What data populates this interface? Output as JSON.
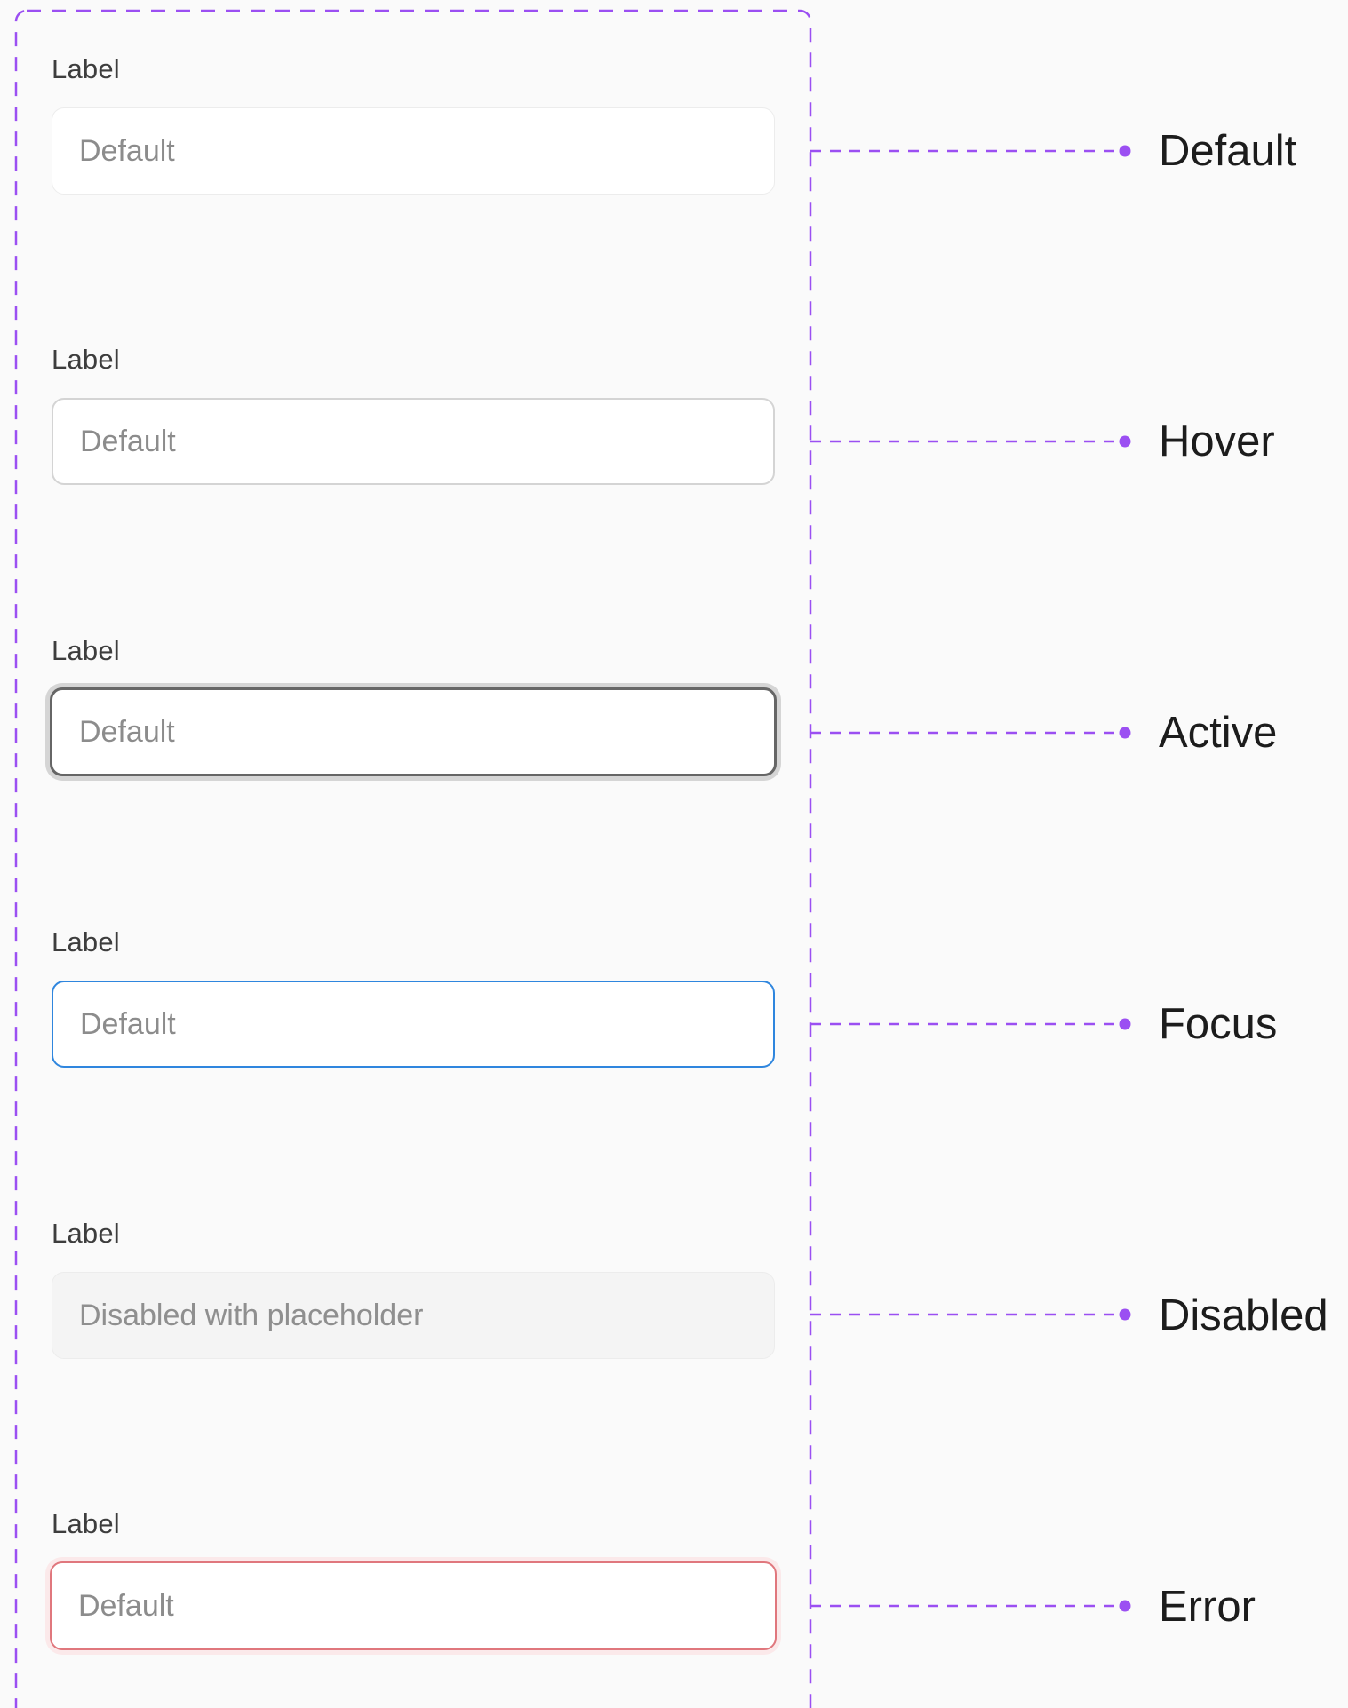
{
  "colors": {
    "annotation": "#9b4ff2",
    "background": "#fafafa",
    "focus_border": "#2f86de",
    "error_border": "#e0777d",
    "active_border": "#666666"
  },
  "states": [
    {
      "id": "default",
      "field_label": "Label",
      "placeholder": "Default",
      "state_label": "Default"
    },
    {
      "id": "hover",
      "field_label": "Label",
      "placeholder": "Default",
      "state_label": "Hover"
    },
    {
      "id": "active",
      "field_label": "Label",
      "placeholder": "Default",
      "state_label": "Active"
    },
    {
      "id": "focus",
      "field_label": "Label",
      "placeholder": "Default",
      "state_label": "Focus"
    },
    {
      "id": "disabled",
      "field_label": "Label",
      "placeholder": "Disabled with placeholder",
      "state_label": "Disabled"
    },
    {
      "id": "error",
      "field_label": "Label",
      "placeholder": "Default",
      "state_label": "Error"
    }
  ]
}
